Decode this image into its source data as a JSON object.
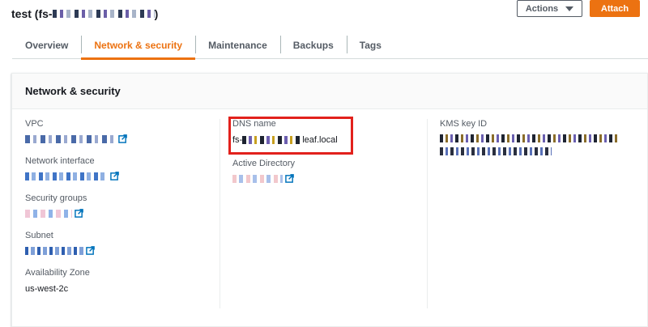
{
  "header": {
    "title_prefix": "test (fs-",
    "title_suffix": ")",
    "actions_label": "Actions",
    "attach_label": "Attach"
  },
  "tabs": [
    {
      "label": "Overview",
      "active": false
    },
    {
      "label": "Network & security",
      "active": true
    },
    {
      "label": "Maintenance",
      "active": false
    },
    {
      "label": "Backups",
      "active": false
    },
    {
      "label": "Tags",
      "active": false
    }
  ],
  "panel": {
    "title": "Network & security",
    "col1": {
      "vpc_label": "VPC",
      "network_interface_label": "Network interface",
      "security_groups_label": "Security groups",
      "subnet_label": "Subnet",
      "availability_zone_label": "Availability Zone",
      "availability_zone_value": "us-west-2c"
    },
    "col2": {
      "dns_label": "DNS name",
      "dns_prefix": "fs-",
      "dns_suffix": "leaf.local",
      "ad_label": "Active Directory"
    },
    "col3": {
      "kms_label": "KMS key ID"
    }
  },
  "colors": {
    "accent": "#ec7211",
    "link": "#0073bb",
    "highlight_box": "#e2211c"
  }
}
